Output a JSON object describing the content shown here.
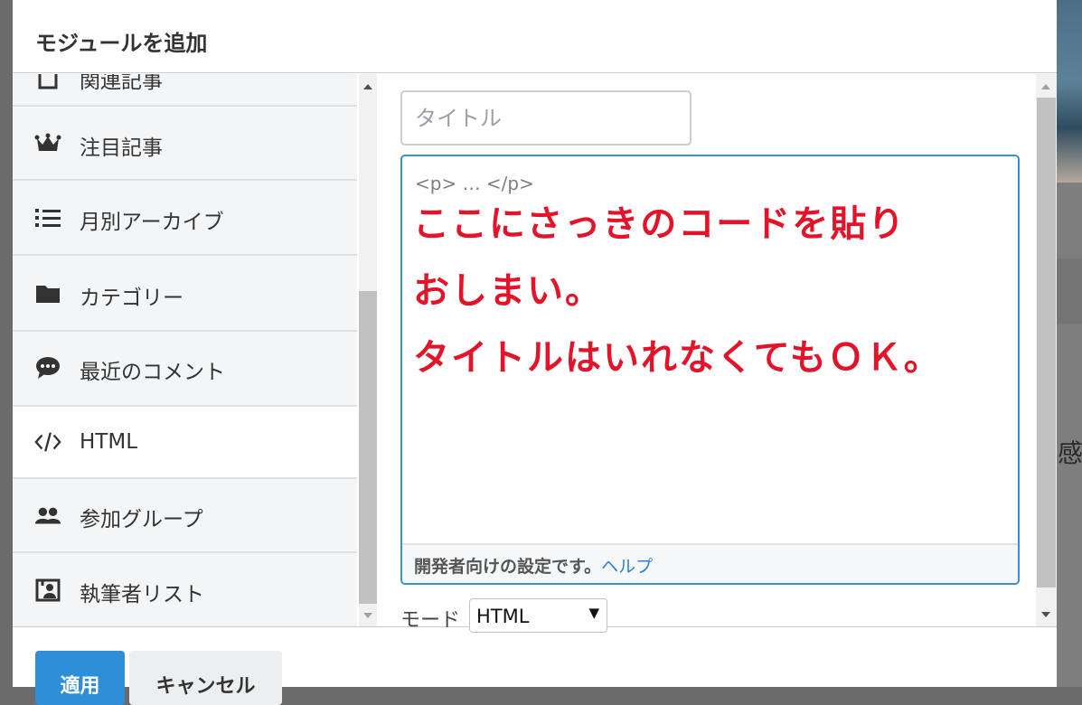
{
  "dialog": {
    "title": "モジュールを追加"
  },
  "module_list": {
    "items": [
      {
        "label": "関連記事",
        "icon": "document-icon",
        "state": "partially-hidden"
      },
      {
        "label": "注目記事",
        "icon": "crown-icon"
      },
      {
        "label": "月別アーカイブ",
        "icon": "list-icon"
      },
      {
        "label": "カテゴリー",
        "icon": "folder-icon"
      },
      {
        "label": "最近のコメント",
        "icon": "comment-icon"
      },
      {
        "label": "HTML",
        "icon": "code-icon",
        "selected": true
      },
      {
        "label": "参加グループ",
        "icon": "group-icon"
      },
      {
        "label": "執筆者リスト",
        "icon": "author-icon"
      }
    ]
  },
  "editor": {
    "title_placeholder": "タイトル",
    "code_placeholder": "<p> … </p>",
    "annotation_lines": [
      "ここにさっきのコードを貼り",
      "おしまい。",
      "タイトルはいれなくてもＯＫ。"
    ],
    "footer_text": "開発者向けの設定です。",
    "footer_link": "ヘルプ",
    "mode_label": "モード",
    "mode_value": "HTML"
  },
  "buttons": {
    "apply": "適用",
    "cancel": "キャンセル"
  },
  "colors": {
    "accent": "#3a8fd6",
    "annotation": "#e3142a",
    "apply_button": "#2f8ed8"
  },
  "background": {
    "partial_text": "感"
  }
}
